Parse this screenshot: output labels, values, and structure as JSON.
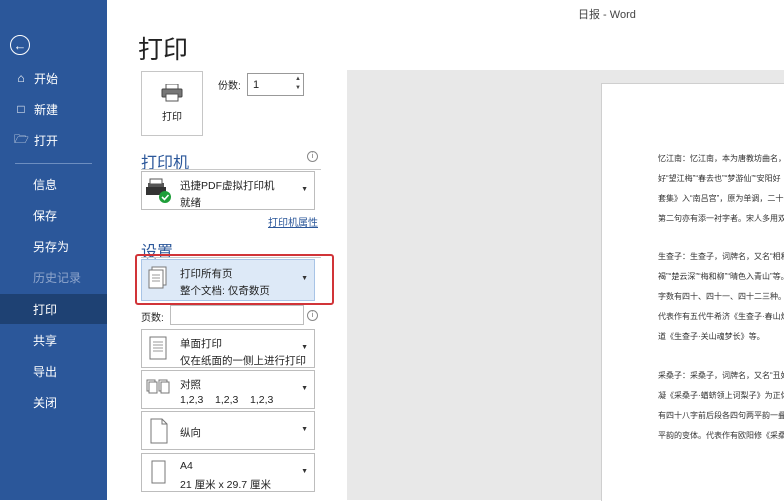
{
  "window": {
    "title": "日报 - Word"
  },
  "sidebar": {
    "back_icon": "back-arrow-icon",
    "items": [
      {
        "label": "开始",
        "icon": "home-icon"
      },
      {
        "label": "新建",
        "icon": "new-document-icon"
      },
      {
        "label": "打开",
        "icon": "open-folder-icon"
      },
      {
        "label": "信息"
      },
      {
        "label": "保存"
      },
      {
        "label": "另存为"
      },
      {
        "label": "历史记录",
        "disabled": true
      },
      {
        "label": "打印",
        "active": true
      },
      {
        "label": "共享"
      },
      {
        "label": "导出"
      },
      {
        "label": "关闭"
      }
    ],
    "color": "#2b579a"
  },
  "main": {
    "title": "打印",
    "print_button_label": "打印",
    "copies_label": "份数:",
    "copies_value": "1",
    "printer_section": "打印机",
    "printer_name": "迅捷PDF虚拟打印机",
    "printer_status": "就绪",
    "printer_properties_link": "打印机属性",
    "settings_section": "设置",
    "settings": [
      {
        "line1": "打印所有页",
        "line2": "整个文档: 仅奇数页",
        "icon": "pages-icon"
      },
      {
        "line1": "单面打印",
        "line2": "仅在纸面的一侧上进行打印",
        "icon": "one-sided-icon"
      },
      {
        "line1": "对照",
        "line2": "1,2,3    1,2,3    1,2,3",
        "icon": "collate-icon"
      },
      {
        "line1": "纵向",
        "line2": "",
        "icon": "portrait-icon"
      },
      {
        "line1": "A4",
        "line2": "21 厘米 x 29.7 厘米",
        "icon": "paper-size-icon"
      }
    ],
    "pages_label": "页数:",
    "pages_value": ""
  },
  "preview": {
    "lines": [
      "忆江南：忆江南，本为唐教坊曲名，段",
      "好“望江梅”“春去也”“梦游仙”“安阳好",
      "套集》入“南吕宫”，原为单调，二十七",
      "第二句亦有添一衬字者。宋人多用双调",
      "生查子：生查子，词牌名，又名“相和",
      "褐”“楚云深”“梅和柳”“晴色入青山”等。",
      "字数有四十、四十一、四十二三种。正",
      "代表作有五代牛希济《生查子·春山烟",
      "道《生查子·关山魂梦长》等。",
      "采桑子：采桑子，词牌名，又名“丑奴",
      "凝《采桑子·蝤蛴领上诃梨子》为正体",
      "有四十八字前后段各四句两平韵一叠韵",
      "平韵的变体。代表作有欧阳修《采桑子"
    ]
  }
}
